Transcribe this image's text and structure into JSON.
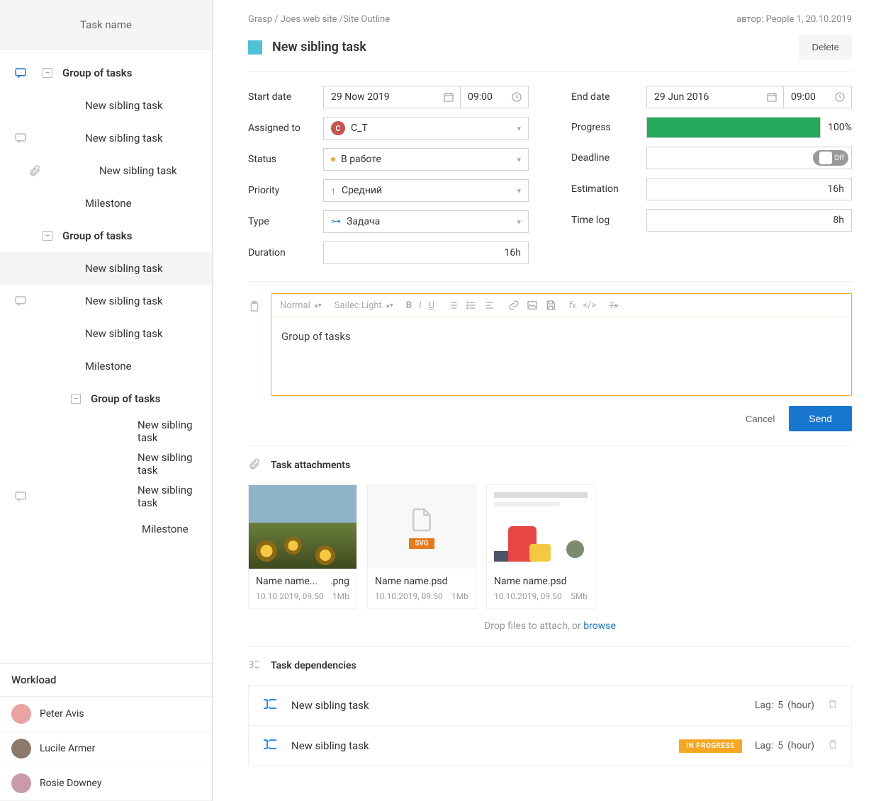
{
  "sidebar": {
    "header": "Task name",
    "tree": [
      {
        "type": "group",
        "icon": "comment-active",
        "label": "Group of tasks",
        "indent": 0,
        "collapsible": true
      },
      {
        "type": "task",
        "icon": "",
        "label": "New sibling task",
        "indent": 1
      },
      {
        "type": "task",
        "icon": "comment",
        "label": "New sibling task",
        "indent": 1
      },
      {
        "type": "task",
        "icon": "clip",
        "label": "New sibling task",
        "indent": 1,
        "clipCol": true
      },
      {
        "type": "task",
        "icon": "",
        "label": "Milestone",
        "indent": 1
      },
      {
        "type": "group",
        "icon": "",
        "label": "Group of tasks",
        "indent": 0,
        "collapsible": true
      },
      {
        "type": "task",
        "icon": "",
        "label": "New sibling task",
        "indent": 1,
        "selected": true
      },
      {
        "type": "task",
        "icon": "comment",
        "label": "New sibling task",
        "indent": 1
      },
      {
        "type": "task",
        "icon": "",
        "label": "New sibling task",
        "indent": 1
      },
      {
        "type": "task",
        "icon": "",
        "label": "Milestone",
        "indent": 1
      },
      {
        "type": "group",
        "icon": "",
        "label": "Group of tasks",
        "indent": 1,
        "collapsible": true
      },
      {
        "type": "task",
        "icon": "",
        "label": "New sibling task",
        "indent": 2
      },
      {
        "type": "task",
        "icon": "",
        "label": "New sibling task",
        "indent": 2
      },
      {
        "type": "task",
        "icon": "comment",
        "label": "New sibling task",
        "indent": 2
      },
      {
        "type": "task",
        "icon": "",
        "label": "Milestone",
        "indent": 2
      }
    ],
    "workload": {
      "header": "Workload",
      "people": [
        {
          "name": "Peter Avis",
          "color": "#e9a3a0"
        },
        {
          "name": "Lucile Armer",
          "color": "#8b7a6b"
        },
        {
          "name": "Rosie Downey",
          "color": "#c99aa8"
        }
      ]
    }
  },
  "breadcrumb": "Grasp / Joes web site /Site Outline",
  "author": "автор: People 1, 20.10.2019",
  "title": "New sibling task",
  "delete_label": "Delete",
  "fields": {
    "start_date_label": "Start date",
    "start_date": "29 Now 2019",
    "start_time": "09:00",
    "end_date_label": "End date",
    "end_date": "29 Jun 2016",
    "end_time": "09:00",
    "assigned_label": "Assigned to",
    "assigned_badge": "C",
    "assigned_value": "C_T",
    "progress_label": "Progress",
    "progress_pct": "100%",
    "status_label": "Status",
    "status_value": "В работе",
    "deadline_label": "Deadline",
    "deadline_toggle": "Off",
    "priority_label": "Priority",
    "priority_value": "Средний",
    "estimation_label": "Estimation",
    "estimation_value": "16h",
    "type_label": "Type",
    "type_value": "Задача",
    "timelog_label": "Time log",
    "timelog_value": "8h",
    "duration_label": "Duration",
    "duration_value": "16h"
  },
  "editor": {
    "style_sel": "Normal",
    "font_sel": "Sailec Light",
    "body": "Group of tasks",
    "cancel": "Cancel",
    "send": "Send"
  },
  "attachments": {
    "header": "Task attachments",
    "items": [
      {
        "name": "Name name...",
        "ext": ".png",
        "date": "10.10.2019, 09.50",
        "size": "1Mb",
        "thumb": "photo"
      },
      {
        "name": "Name name.psd",
        "ext": "",
        "date": "10.10.2019, 09.50",
        "size": "1Mb",
        "thumb": "svg"
      },
      {
        "name": "Name name.psd",
        "ext": "",
        "date": "10.10.2019, 09.50",
        "size": "5Mb",
        "thumb": "illustration"
      }
    ],
    "drop_text": "Drop files to attach, or ",
    "browse": "browse"
  },
  "dependencies": {
    "header": "Task dependencies",
    "items": [
      {
        "name": "New sibling task",
        "status": "",
        "lag_label": "Lag:",
        "lag_val": "5",
        "lag_unit": "(hour)"
      },
      {
        "name": "New sibling task",
        "status": "IN PROGRESS",
        "lag_label": "Lag:",
        "lag_val": "5",
        "lag_unit": "(hour)"
      }
    ]
  }
}
